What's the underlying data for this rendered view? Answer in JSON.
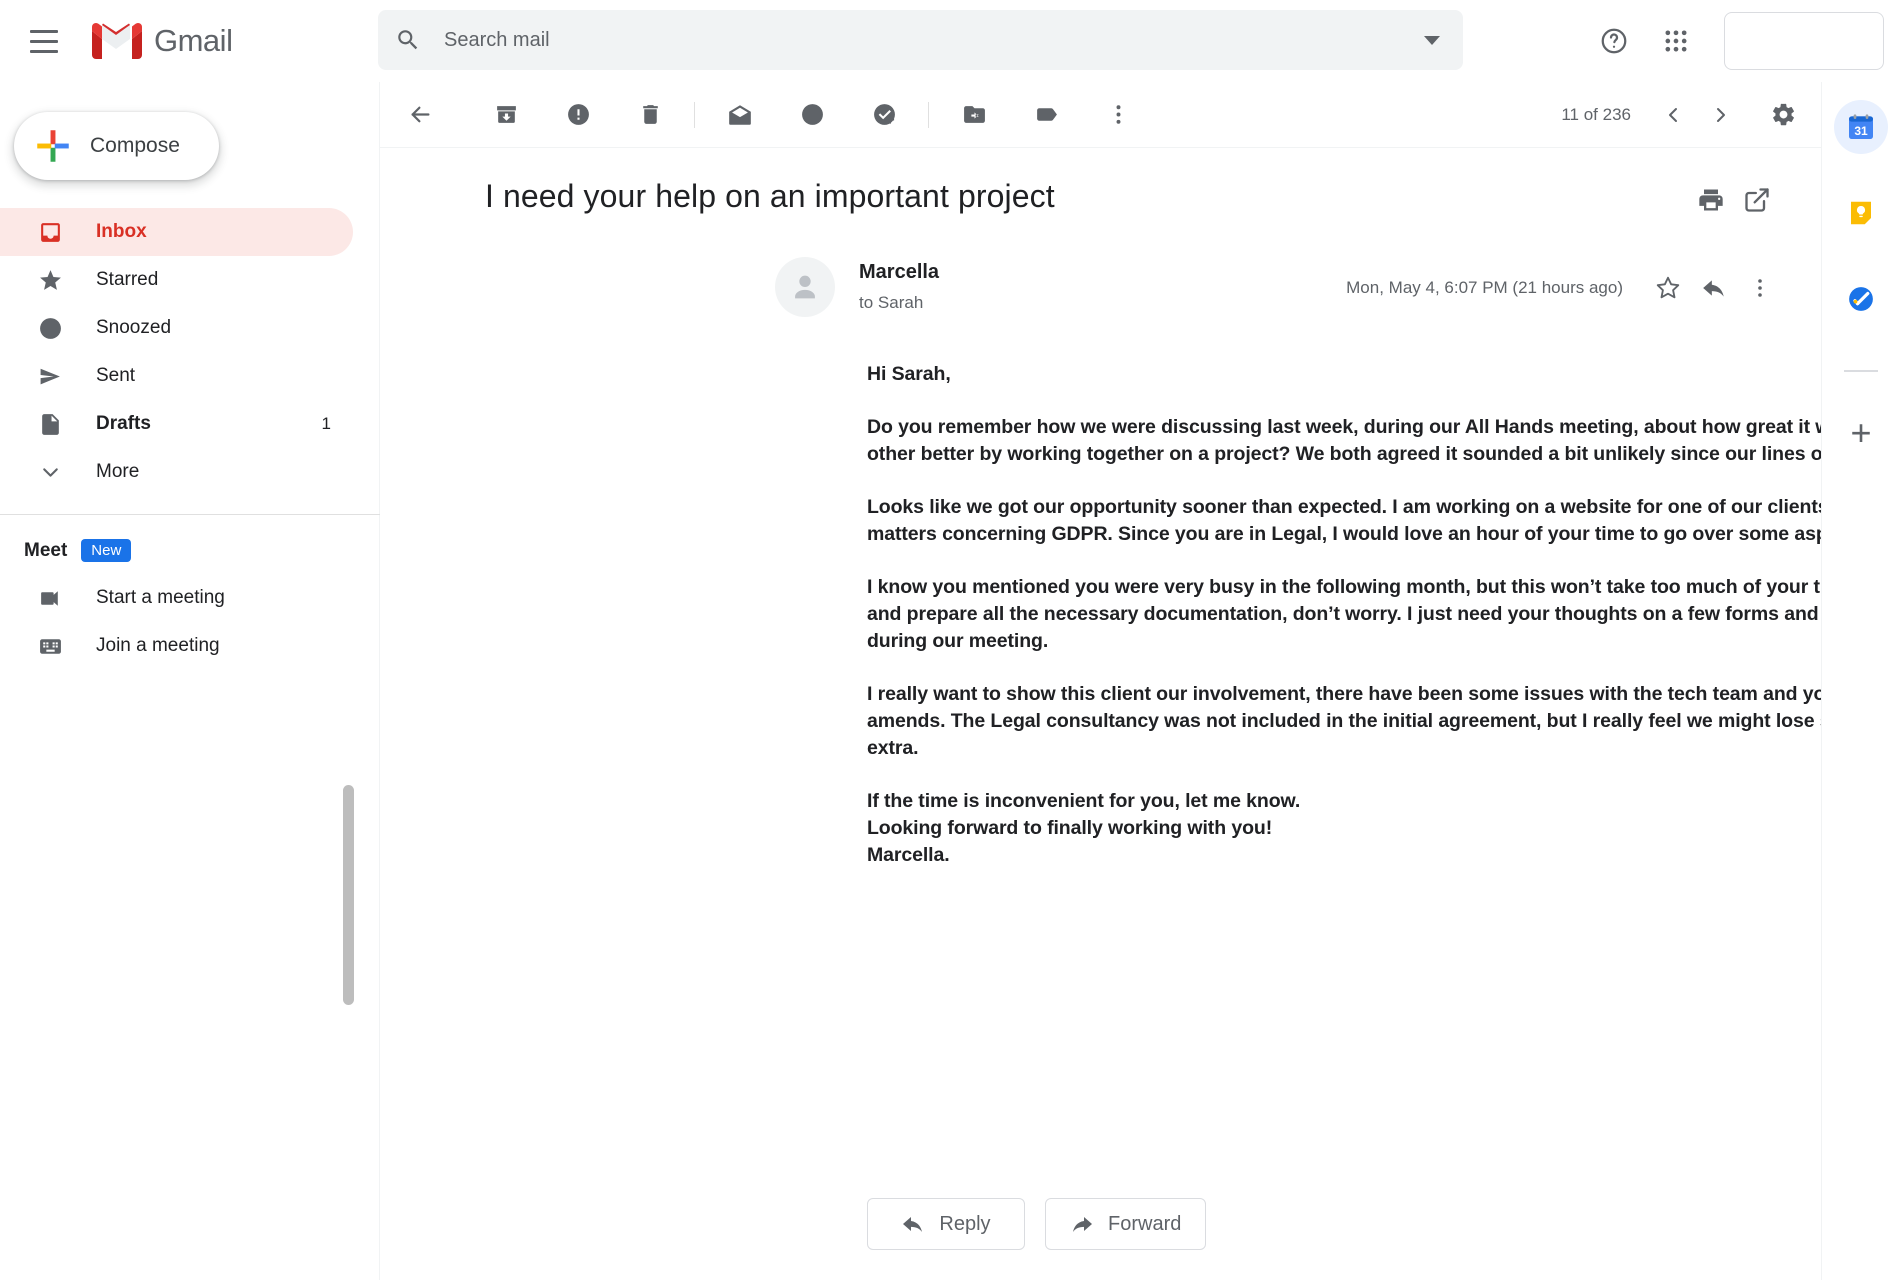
{
  "header": {
    "menu_icon": "hamburger-menu-icon",
    "brand": "Gmail",
    "logo_icon": "gmail-logo-icon",
    "search": {
      "placeholder": "Search mail",
      "value": "",
      "icon": "search-icon",
      "options_icon": "chevron-down-icon"
    },
    "help_icon": "help-circle-icon",
    "apps_icon": "apps-grid-icon",
    "avatar_label": ""
  },
  "sidebar": {
    "compose": {
      "label": "Compose",
      "icon": "plus-icon"
    },
    "items": [
      {
        "label": "Inbox",
        "icon": "inbox-icon",
        "count": "",
        "active": true
      },
      {
        "label": "Starred",
        "icon": "star-icon",
        "count": "",
        "active": false
      },
      {
        "label": "Snoozed",
        "icon": "clock-icon",
        "count": "",
        "active": false
      },
      {
        "label": "Sent",
        "icon": "send-icon",
        "count": "",
        "active": false
      },
      {
        "label": "Drafts",
        "icon": "draft-icon",
        "count": "1",
        "active": false
      },
      {
        "label": "More",
        "icon": "chevron-down-icon",
        "count": "",
        "active": false
      }
    ],
    "meet": {
      "title": "Meet",
      "badge": "New",
      "items": [
        {
          "label": "Start a meeting",
          "icon": "video-camera-icon"
        },
        {
          "label": "Join a meeting",
          "icon": "keyboard-icon"
        }
      ]
    }
  },
  "toolbar": {
    "back_icon": "back-arrow-icon",
    "archive_icon": "archive-icon",
    "spam_icon": "report-spam-icon",
    "delete_icon": "trash-icon",
    "unread_icon": "mark-unread-icon",
    "snooze_icon": "clock-snooze-icon",
    "task_icon": "add-to-tasks-icon",
    "move_icon": "move-to-folder-icon",
    "label_icon": "label-icon",
    "more_icon": "more-vertical-icon",
    "page_count": "11 of 236",
    "prev_icon": "chevron-left-icon",
    "next_icon": "chevron-right-icon",
    "settings_icon": "gear-icon"
  },
  "email": {
    "subject": "I need your help on an important project",
    "print_icon": "printer-icon",
    "popout_icon": "open-in-new-icon",
    "sender": "Marcella",
    "to_prefix": "to",
    "recipient": "Sarah",
    "date": "Mon, May 4, 6:07 PM (21 hours ago)",
    "star_icon": "star-outline-icon",
    "reply_arrow_icon": "reply-arrow-icon",
    "more_icon": "more-vertical-icon",
    "avatar_icon": "person-avatar-icon",
    "body": [
      "Hi Sarah,",
      "Do you remember how we were discussing last week, during our All Hands meeting, about how great it would be if we got to know each other better by working together on a project? We both agreed it sounded a bit unlikely since our lines of work hardly intersect.",
      "Looks like we got our opportunity sooner than expected. I am working on a website for one of our clients and I stumbled upon some legal matters concerning GDPR. Since you are in Legal, I would love an hour of your time to go over some aspects and find solutions for them.",
      "I know you mentioned you were very busy in the following month, but this won’t take too much of your time. I’ll set a time in your calendar and prepare all the necessary documentation, don’t worry. I just need your thoughts on a few forms and we’ll have time to go over them during our meeting.",
      "I really want to show this client our involvement, there have been some issues with the tech team and your expertise is our chance to make amends. The Legal consultancy was not included in the initial agreement, but I really feel we might lose so I want to offer this to them as an extra.",
      "If the time is inconvenient for you, let me know.\nLooking forward to finally working with you!\nMarcella."
    ],
    "reply_button": "Reply",
    "forward_button": "Forward",
    "reply_icon": "reply-arrow-icon",
    "forward_icon": "forward-arrow-icon"
  },
  "addons": {
    "items": [
      {
        "name": "google-calendar-icon",
        "label": "31",
        "selected": true
      },
      {
        "name": "google-keep-icon",
        "label": "",
        "selected": false
      },
      {
        "name": "google-tasks-icon",
        "label": "",
        "selected": false
      }
    ],
    "add_label": "+"
  },
  "colors": {
    "accent_red": "#d93025",
    "inbox_bg": "#fce8e6",
    "blue": "#1a73e8",
    "grey_icon": "#5f6368",
    "text": "#202124"
  }
}
